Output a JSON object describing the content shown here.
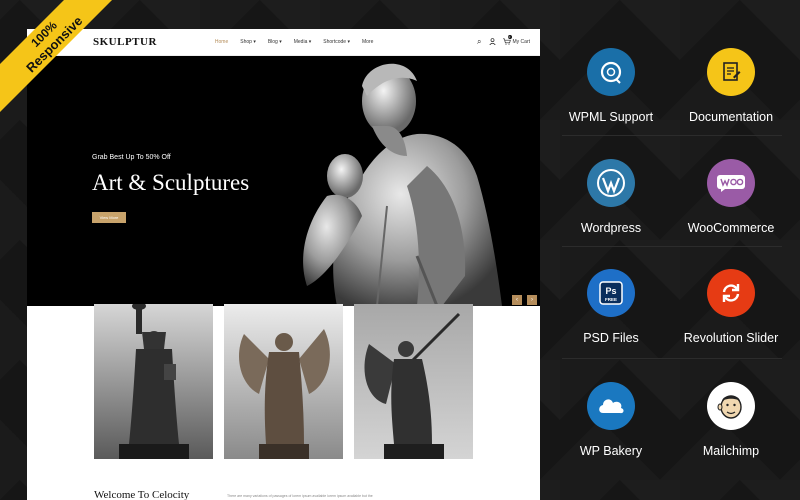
{
  "ribbon": {
    "line1": "100%",
    "line2": "Responsive"
  },
  "site": {
    "logo": "SKULPTUR",
    "menu": [
      {
        "label": "Home",
        "active": true
      },
      {
        "label": "Shop ▾",
        "active": false
      },
      {
        "label": "Blog ▾",
        "active": false
      },
      {
        "label": "Media ▾",
        "active": false
      },
      {
        "label": "Shortcode ▾",
        "active": false
      },
      {
        "label": "More",
        "active": false
      }
    ],
    "cart_label": "My Cart",
    "cart_count": "0",
    "hero": {
      "subtitle": "Grab Best Up To 50% Off",
      "title": "Art & Sculptures",
      "button": "View More"
    },
    "welcome_title": "Welcome To Celocity",
    "welcome_text": "There are many variations of passages of lorem ipsum available lorem ipsum available but the"
  },
  "features": [
    {
      "label": "WPML Support",
      "icon": "wpml-icon",
      "color": "#1a6fa8"
    },
    {
      "label": "Documentation",
      "icon": "documentation-icon",
      "color": "#f5c518"
    },
    {
      "label": "Wordpress",
      "icon": "wordpress-icon",
      "color": "#2d78a8"
    },
    {
      "label": "WooCommerce",
      "icon": "woocommerce-icon",
      "color": "#9a5ba6"
    },
    {
      "label": "PSD Files",
      "icon": "photoshop-icon",
      "color": "#1e6fc7"
    },
    {
      "label": "Revolution Slider",
      "icon": "refresh-icon",
      "color": "#e63b14"
    },
    {
      "label": "WP Bakery",
      "icon": "cloud-icon",
      "color": "#1a78c0"
    },
    {
      "label": "Mailchimp",
      "icon": "mailchimp-icon",
      "color": "#ffffff"
    }
  ]
}
